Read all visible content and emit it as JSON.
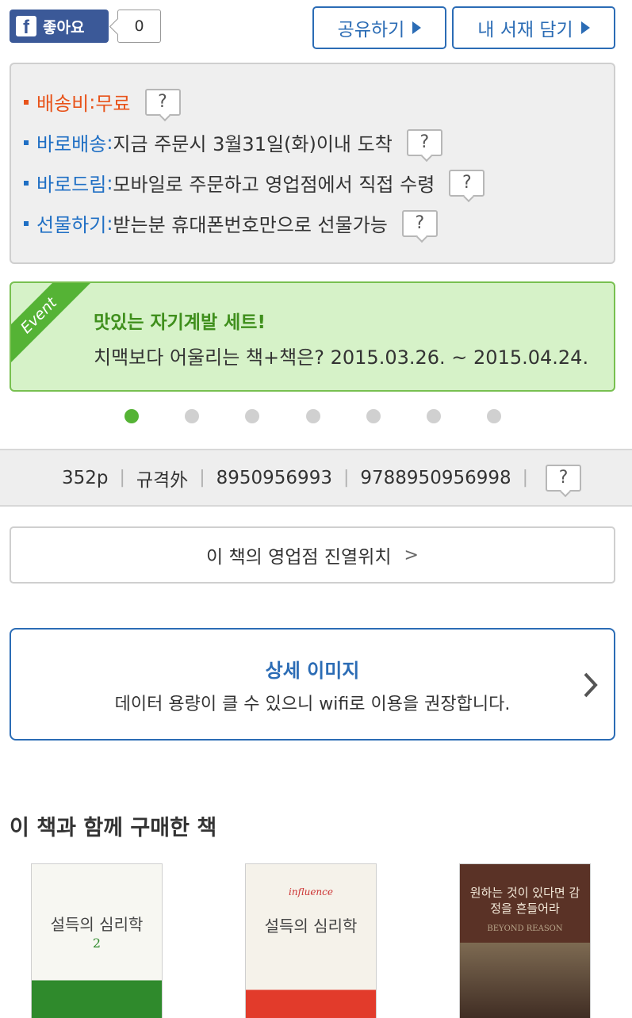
{
  "social": {
    "like_label": "좋아요",
    "like_count": "0",
    "share_label": "공유하기",
    "shelf_label": "내 서재 담기"
  },
  "delivery": {
    "items": [
      {
        "label": "배송비",
        "sep": " : ",
        "value": "무료",
        "color": "#e8531a"
      },
      {
        "label": "바로배송",
        "sep": " : ",
        "value": "지금 주문시 3월31일(화)이내 도착",
        "color": "#1f6fc4"
      },
      {
        "label": "바로드림",
        "sep": " : ",
        "value": "모바일로 주문하고 영업점에서 직접 수령",
        "color": "#1f6fc4"
      },
      {
        "label": "선물하기",
        "sep": " : ",
        "value": "받는분 휴대폰번호만으로 선물가능",
        "color": "#1f6fc4"
      }
    ],
    "help_label": "?"
  },
  "event": {
    "ribbon": "Event",
    "title": "맛있는 자기계발 세트!",
    "description": "치맥보다 어울리는 책+책은? 2015.03.26. ~ 2015.04.24.",
    "slide_count": 7,
    "active_slide": 1
  },
  "specs": {
    "pages": "352p",
    "format": "규격外",
    "isbn10": "8950956993",
    "isbn13": "9788950956998",
    "help_label": "?"
  },
  "store_location": {
    "label": "이 책의 영업점 진열위치",
    "chevron": ">"
  },
  "detail_image": {
    "title": "상세 이미지",
    "subtitle": "데이터 용량이 클 수 있으니 wifi로 이용을 권장합니다."
  },
  "together": {
    "title": "이 책과 함께 구매한 책",
    "books": [
      {
        "cover_title": "설득의 심리학",
        "cover_number": "2"
      },
      {
        "cover_title": "설득의 심리학",
        "cover_tag": "influence"
      },
      {
        "cover_title": "원하는 것이 있다면 감정을 흔들어라",
        "cover_tag": "BEYOND REASON"
      }
    ]
  },
  "colors": {
    "accent_blue": "#2b6cb5",
    "event_green": "#55b335",
    "orange": "#e8531a"
  }
}
